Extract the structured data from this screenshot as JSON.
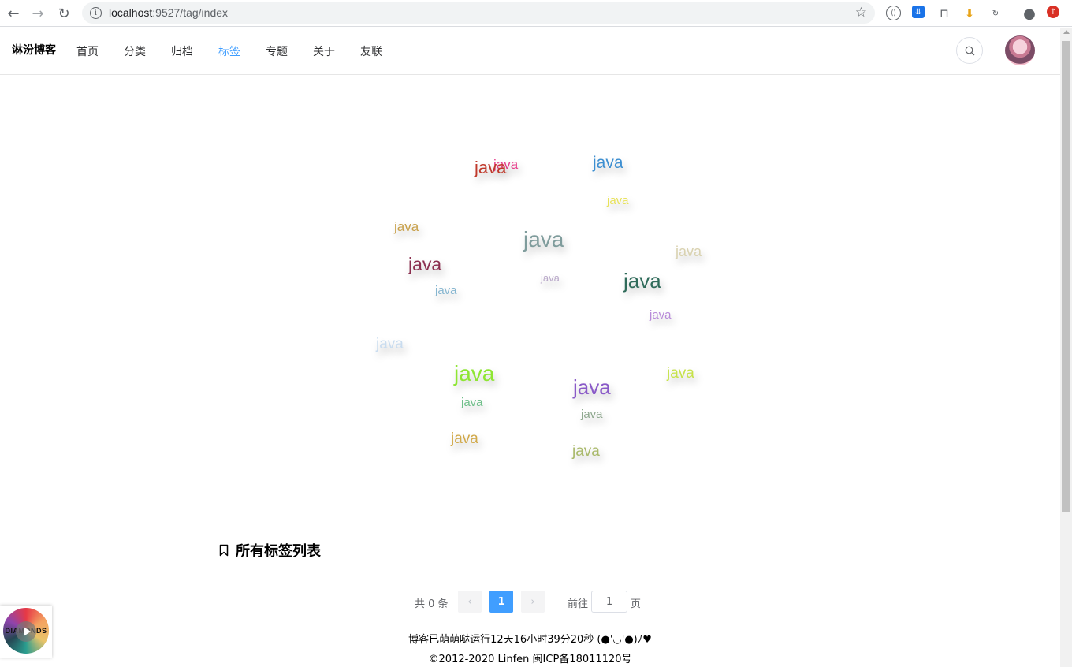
{
  "browser": {
    "url_host": "localhost",
    "url_path": ":9527/tag/index"
  },
  "header": {
    "brand": "淋汾博客",
    "nav": [
      {
        "label": "首页",
        "active": false
      },
      {
        "label": "分类",
        "active": false
      },
      {
        "label": "归档",
        "active": false
      },
      {
        "label": "标签",
        "active": true
      },
      {
        "label": "专题",
        "active": false
      },
      {
        "label": "关于",
        "active": false
      },
      {
        "label": "友联",
        "active": false
      }
    ]
  },
  "tag_cloud": {
    "tags": [
      {
        "text": "java",
        "color": "#e83e8c"
      },
      {
        "text": "java",
        "color": "#c0392b"
      },
      {
        "text": "java",
        "color": "#3d8fd1"
      },
      {
        "text": "java",
        "color": "#e8e25a"
      },
      {
        "text": "java",
        "color": "#c8a04a"
      },
      {
        "text": "java",
        "color": "#7f9c9c"
      },
      {
        "text": "java",
        "color": "#d9d2b0"
      },
      {
        "text": "java",
        "color": "#8b2f4f"
      },
      {
        "text": "java",
        "color": "#b9a9c9"
      },
      {
        "text": "java",
        "color": "#2f6b5a"
      },
      {
        "text": "java",
        "color": "#86b6d0"
      },
      {
        "text": "java",
        "color": "#b88ad9"
      },
      {
        "text": "java",
        "color": "#c9dcef"
      },
      {
        "text": "java",
        "color": "#8ee632"
      },
      {
        "text": "java",
        "color": "#8a5ac8"
      },
      {
        "text": "java",
        "color": "#c6e24a"
      },
      {
        "text": "java",
        "color": "#6fbf8a"
      },
      {
        "text": "java",
        "color": "#8fa88f"
      },
      {
        "text": "java",
        "color": "#d1a94a"
      },
      {
        "text": "java",
        "color": "#a9b96a"
      }
    ]
  },
  "section": {
    "title": "所有标签列表"
  },
  "pagination": {
    "total": "共 0 条",
    "prev": "‹",
    "next": "›",
    "current_page": "1",
    "goto_label": "前往",
    "goto_value": "1",
    "page_suffix": "页"
  },
  "footer": {
    "runtime": "博客已萌萌哒运行12天16小时39分20秒 (●'◡'●)ﾉ♥",
    "copyright": "©2012-2020 Linfen 闽ICP备18011120号"
  },
  "music": {
    "label": "DIAMONDS"
  }
}
